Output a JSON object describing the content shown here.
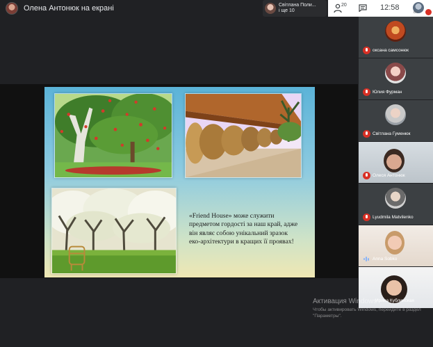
{
  "presenter": {
    "name": "Олена Антонюк на екрані"
  },
  "speaker": {
    "line1": "Світлана Поли...",
    "line2": "і ще 10"
  },
  "controls": {
    "people_count": "20",
    "time": "12:58",
    "me_label": "Ви"
  },
  "slide": {
    "text": "«Friend House» може служити предметом гордості за наш край, адже він являє собою унікальний зразок еко-архітектури в кращих її проявах!"
  },
  "participants": [
    {
      "name": "оксана самсонюк",
      "mic": "muted"
    },
    {
      "name": "Юлия Фурман",
      "mic": "muted"
    },
    {
      "name": "Світлана Гуменюк",
      "mic": "muted"
    },
    {
      "name": "Олеся Антонюк",
      "mic": "muted"
    },
    {
      "name": "Lyudmila Matvilenko",
      "mic": "muted"
    },
    {
      "name": "Anna Sobko",
      "mic": "speaking"
    },
    {
      "name": "Ирина Кублинская",
      "mic": "none"
    }
  ],
  "watermark": {
    "title": "Активация Windows",
    "body": "Чтобы активировать Windows, перейдите в раздел \"Параметры\"."
  },
  "colors": {
    "background": "#202124",
    "tile": "#3c4043",
    "mute_red": "#d93025",
    "speaking_blue": "#8ab4f8"
  }
}
